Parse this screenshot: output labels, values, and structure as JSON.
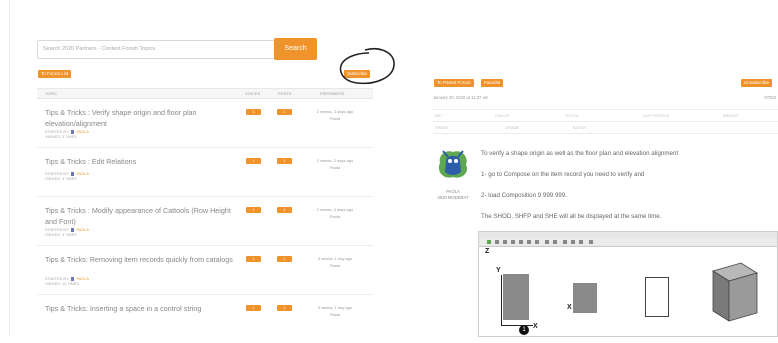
{
  "search": {
    "placeholder": "Search 2020 Partners - Content Forum Topics",
    "button_label": "Search"
  },
  "left_nav": {
    "to_forum_list": "To Forum List",
    "subscribe": "Subscribe"
  },
  "topics_table": {
    "headers": [
      "Topic",
      "Voices",
      "Posts",
      "Freshness"
    ],
    "rows": [
      {
        "title": "Tips & Tricks : Verify shape origin and floor plan elevation/alignment",
        "started_label": "Started by:",
        "author": "Paola",
        "viewed": "Viewed: 3 times",
        "voices": "1",
        "posts": "1",
        "fresh_time": "2 weeks, 3 days ago",
        "fresh_author": "Paola"
      },
      {
        "title": "Tips & Tricks : Edit Relations",
        "started_label": "Started by:",
        "author": "Paola",
        "viewed": "Viewed: 3 times",
        "voices": "1",
        "posts": "1",
        "fresh_time": "2 weeks, 3 days ago",
        "fresh_author": "Paola"
      },
      {
        "title": "Tips & Tricks : Modify appearance of Cattools (Row Height and Font)",
        "started_label": "Started by:",
        "author": "Paola",
        "viewed": "Viewed: 3 times",
        "voices": "1",
        "posts": "1",
        "fresh_time": "2 weeks, 3 days ago",
        "fresh_author": "Paola"
      },
      {
        "title": "Tips & Tricks: Removing item records quickly from catalogs",
        "started_label": "Started by:",
        "author": "Paola",
        "viewed": "Viewed: 10 times",
        "voices": "1",
        "posts": "1",
        "fresh_time": "3 weeks, 1 day ago",
        "fresh_author": "Paola"
      },
      {
        "title": "Tips & Tricks: Inserting a space in a control string",
        "started_label": "",
        "author": "",
        "viewed": "",
        "voices": "1",
        "posts": "1",
        "fresh_time": "3 weeks, 1 day ago",
        "fresh_author": "Paola"
      }
    ]
  },
  "post": {
    "to_parent_forum": "To Parent Forum",
    "favorite": "Favorite",
    "unsubscribe": "Unsubscribe",
    "date": "January 20, 2016 at 11:37 am",
    "post_number": "#7003",
    "fields_row1": [
      "Key",
      "Color",
      "Stock",
      "Cut Profile",
      "Weight"
    ],
    "fields_row2": [
      "Finish",
      "Grade",
      "Batch"
    ],
    "author_name": "Paola",
    "author_role": "2020 Moderat",
    "lines": [
      "To verify a shape origin as well as the floor plan and elevation alignment",
      "1- go to Compose on the item record you need to verify and",
      "2- load Composition 9 999 999.",
      "The SHOD, SHFP and SHE will all be displayed at the same time."
    ]
  },
  "cad_view": {
    "axis_labels": [
      "Y",
      "X",
      "Z",
      "X"
    ],
    "markers": [
      "1"
    ]
  },
  "colors": {
    "accent": "#f0932b",
    "author_link": "#f0932b",
    "avatar_blue": "#2e5eaa",
    "avatar_green": "#5fa84f"
  }
}
